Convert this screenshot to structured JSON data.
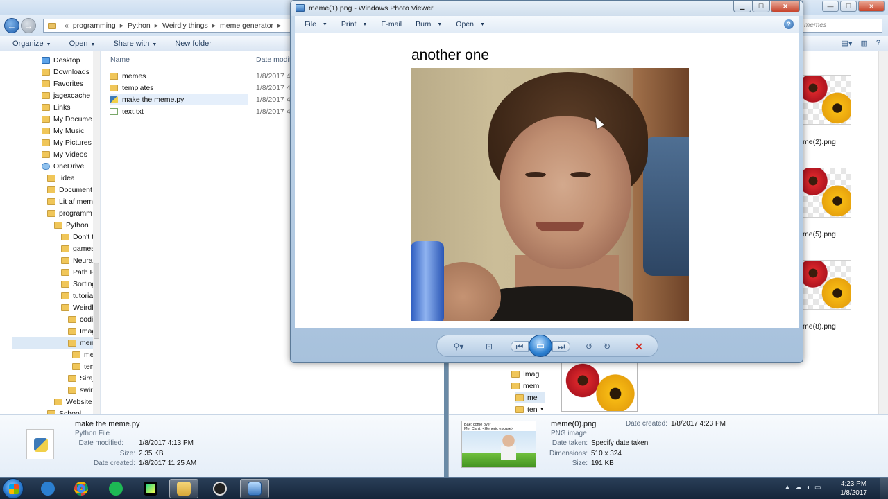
{
  "explorer_left": {
    "breadcrumb": [
      "programming",
      "Python",
      "Weirdly things",
      "meme generator"
    ],
    "toolbar": {
      "organize": "Organize",
      "open": "Open",
      "share_with": "Share with",
      "new_folder": "New folder"
    },
    "nav_items": [
      {
        "label": "Desktop",
        "icon": "folder-blue-icon"
      },
      {
        "label": "Downloads",
        "icon": "folder-icon"
      },
      {
        "label": "Favorites",
        "icon": "folder-icon"
      },
      {
        "label": "jagexcache",
        "icon": "folder-icon"
      },
      {
        "label": "Links",
        "icon": "folder-icon"
      },
      {
        "label": "My Docume",
        "icon": "folder-icon"
      },
      {
        "label": "My Music",
        "icon": "folder-icon"
      },
      {
        "label": "My Pictures",
        "icon": "folder-icon"
      },
      {
        "label": "My Videos",
        "icon": "folder-icon"
      },
      {
        "label": "OneDrive",
        "icon": "cloud-icon"
      },
      {
        "label": ".idea",
        "icon": "folder-icon"
      },
      {
        "label": "Document",
        "icon": "folder-icon"
      },
      {
        "label": "Lit af mem",
        "icon": "folder-icon"
      },
      {
        "label": "programm",
        "icon": "folder-icon"
      },
      {
        "label": "Python",
        "icon": "folder-icon"
      },
      {
        "label": "Don't t",
        "icon": "folder-icon"
      },
      {
        "label": "games",
        "icon": "folder-icon"
      },
      {
        "label": "Neural",
        "icon": "folder-icon"
      },
      {
        "label": "Path Fi",
        "icon": "folder-icon"
      },
      {
        "label": "Sorting",
        "icon": "folder-icon"
      },
      {
        "label": "tutoria",
        "icon": "folder-icon"
      },
      {
        "label": "Weirdly",
        "icon": "folder-icon"
      },
      {
        "label": "codir",
        "icon": "folder-icon"
      },
      {
        "label": "Imag",
        "icon": "folder-icon"
      },
      {
        "label": "mem",
        "icon": "folder-icon"
      },
      {
        "label": "me",
        "icon": "folder-icon"
      },
      {
        "label": "ten",
        "icon": "folder-icon"
      },
      {
        "label": "Siraj",
        "icon": "folder-icon"
      },
      {
        "label": "swirl",
        "icon": "folder-icon"
      },
      {
        "label": "Website",
        "icon": "folder-icon"
      },
      {
        "label": "School",
        "icon": "folder-icon"
      }
    ],
    "columns": {
      "name": "Name",
      "date": "Date modifi"
    },
    "files": [
      {
        "name": "memes",
        "date": "1/8/2017 4:",
        "kind": "folder"
      },
      {
        "name": "templates",
        "date": "1/8/2017 4:",
        "kind": "folder"
      },
      {
        "name": "make the meme.py",
        "date": "1/8/2017 4:",
        "kind": "python"
      },
      {
        "name": "text.txt",
        "date": "1/8/2017 4:",
        "kind": "text"
      }
    ],
    "details": {
      "name": "make the meme.py",
      "kind": "Python File",
      "modified_label": "Date modified:",
      "modified": "1/8/2017 4:13 PM",
      "size_label": "Size:",
      "size": "2.35 KB",
      "created_label": "Date created:",
      "created": "1/8/2017 11:25 AM"
    }
  },
  "explorer_right": {
    "search_placeholder": "memes",
    "thumb_labels": [
      "me(2).png",
      "me(5).png",
      "me(8).png"
    ],
    "nav_items": [
      "Imag",
      "mem",
      "me",
      "ten"
    ],
    "details": {
      "name": "meme(0).png",
      "kind": "PNG image",
      "date_taken_label": "Date taken:",
      "date_taken": "Specify date taken",
      "dimensions_label": "Dimensions:",
      "dimensions": "510 x 324",
      "size_label": "Size:",
      "size": "191 KB",
      "created_label": "Date created:",
      "created": "1/8/2017 4:23 PM",
      "thumb_caption_1": "Bae: come over",
      "thumb_caption_2": "Me: Can't, <Generic excuse>"
    }
  },
  "viewer": {
    "title": "meme(1).png - Windows Photo Viewer",
    "menu": [
      "File",
      "Print",
      "E-mail",
      "Burn",
      "Open"
    ],
    "meme_caption": "another one"
  },
  "taskbar": {
    "time": "4:23 PM",
    "date": "1/8/2017",
    "apps": [
      "onedrive-icon",
      "chrome-icon",
      "spotify-icon",
      "pycharm-icon",
      "explorer-icon",
      "obs-icon",
      "photo-viewer-icon"
    ]
  },
  "colors": {
    "accent": "#2b7fd0",
    "delete": "#d42a1f",
    "taskbar": "#15253a"
  }
}
